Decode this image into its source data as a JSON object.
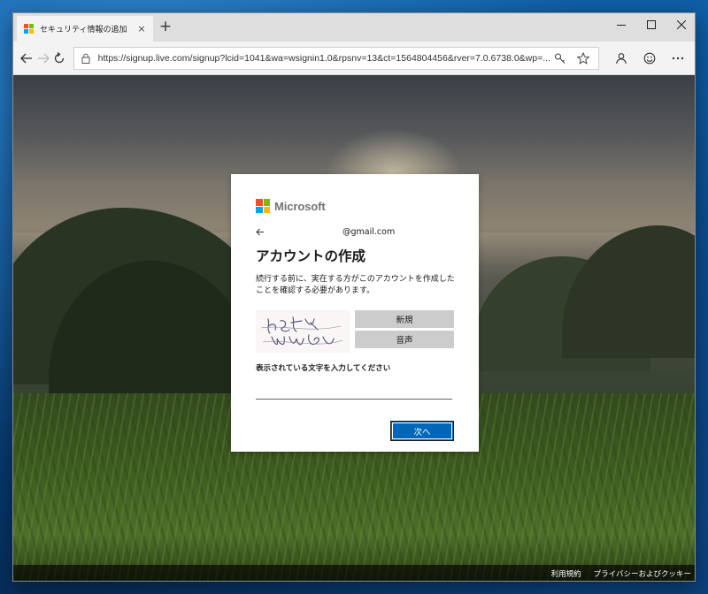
{
  "browser": {
    "tab": {
      "title": "セキュリティ情報の追加",
      "close_glyph": "×"
    },
    "new_tab_glyph": "+",
    "window_controls": {
      "minimize": "minimize-icon",
      "maximize": "maximize-icon",
      "close": "close-icon"
    },
    "address": {
      "url": "https://signup.live.com/signup?lcid=1041&wa=wsignin1.0&rpsnv=13&ct=1564804456&rver=7.0.6738.0&wp=..."
    },
    "icons": {
      "back": "back-arrow-icon",
      "forward": "forward-arrow-icon",
      "refresh": "refresh-icon",
      "lock": "lock-icon",
      "key": "key-icon",
      "favorite": "star-icon",
      "profile": "person-icon",
      "feedback": "smiley-icon",
      "more": "more-icon"
    }
  },
  "dialog": {
    "brand": "Microsoft",
    "identity": "@gmail.com",
    "title": "アカウントの作成",
    "description": "続行する前に、実在する方がこのアカウントを作成したことを確認する必要があります。",
    "captcha_buttons": {
      "new": "新規",
      "audio": "音声"
    },
    "field_label": "表示されている文字を入力してください",
    "field_value": "",
    "next_button": "次へ"
  },
  "footer": {
    "terms": "利用規約",
    "privacy": "プライバシーおよびクッキー"
  },
  "colors": {
    "ms_red": "#f25022",
    "ms_green": "#7fba00",
    "ms_blue": "#00a4ef",
    "ms_yellow": "#ffb900",
    "primary_button": "#0067b8",
    "secondary_button": "#cccccc"
  }
}
